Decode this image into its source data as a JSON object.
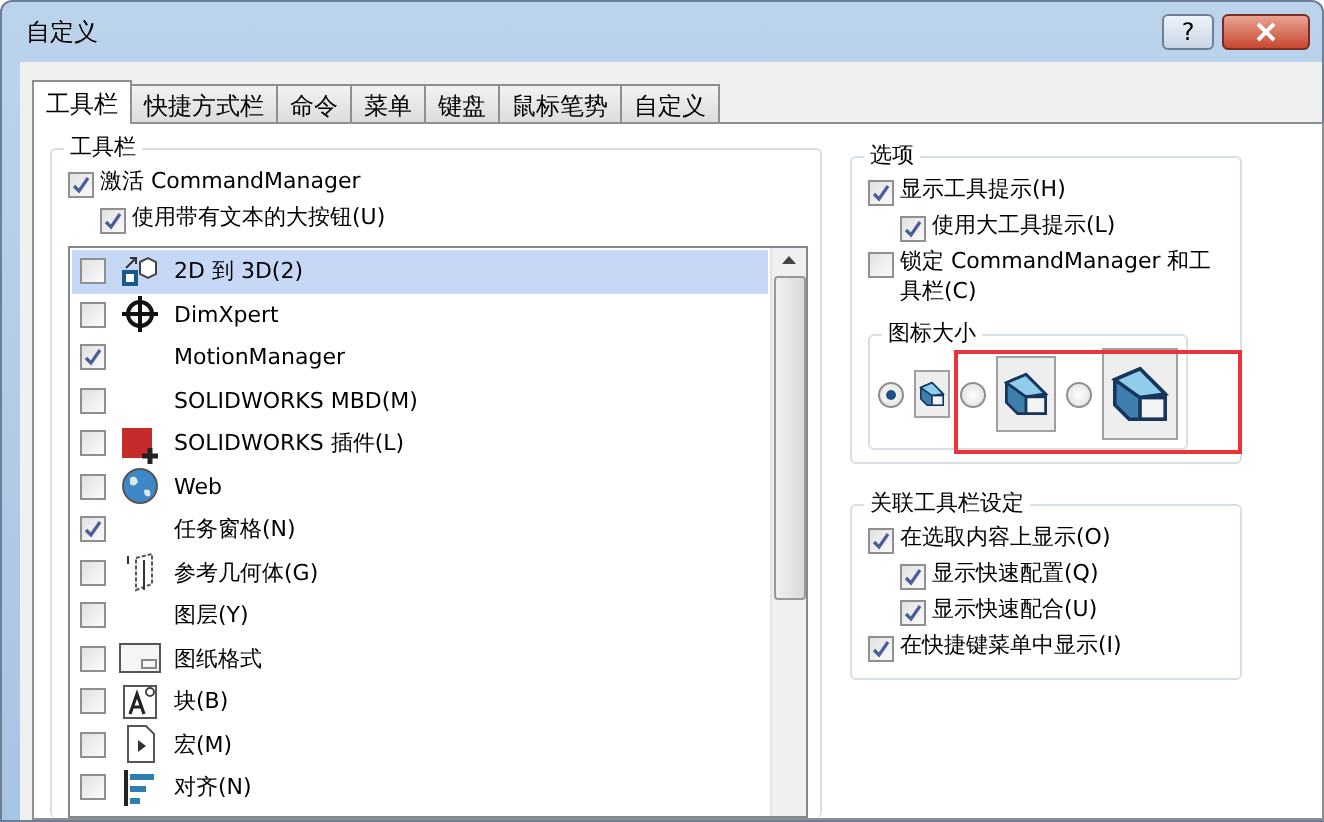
{
  "window": {
    "title": "自定义",
    "help_button": "?"
  },
  "tabs": [
    {
      "label": "工具栏",
      "selected": true
    },
    {
      "label": "快捷方式栏",
      "selected": false
    },
    {
      "label": "命令",
      "selected": false
    },
    {
      "label": "菜单",
      "selected": false
    },
    {
      "label": "键盘",
      "selected": false
    },
    {
      "label": "鼠标笔势",
      "selected": false
    },
    {
      "label": "自定义",
      "selected": false
    }
  ],
  "toolbars": {
    "title": "工具栏",
    "options": [
      {
        "label": "激活 CommandManager",
        "checked": true,
        "indented": false
      },
      {
        "label": "使用带有文本的大按钮(U)",
        "checked": true,
        "indented": true
      }
    ],
    "items": [
      {
        "label": "2D 到 3D(2)",
        "checked": false,
        "selected": true,
        "kind": "cube"
      },
      {
        "label": "DimXpert",
        "checked": false,
        "selected": false,
        "kind": "crosshair"
      },
      {
        "label": "MotionManager",
        "checked": true,
        "selected": false,
        "kind": "none"
      },
      {
        "label": "SOLIDWORKS MBD(M)",
        "checked": false,
        "selected": false,
        "kind": "none"
      },
      {
        "label": "SOLIDWORKS 插件(L)",
        "checked": false,
        "selected": false,
        "kind": "addin"
      },
      {
        "label": "Web",
        "checked": false,
        "selected": false,
        "kind": "globe"
      },
      {
        "label": "任务窗格(N)",
        "checked": true,
        "selected": false,
        "kind": "none"
      },
      {
        "label": "参考几何体(G)",
        "checked": false,
        "selected": false,
        "kind": "plane"
      },
      {
        "label": "图层(Y)",
        "checked": false,
        "selected": false,
        "kind": "none"
      },
      {
        "label": "图纸格式",
        "checked": false,
        "selected": false,
        "kind": "sheet"
      },
      {
        "label": "块(B)",
        "checked": false,
        "selected": false,
        "kind": "block"
      },
      {
        "label": "宏(M)",
        "checked": false,
        "selected": false,
        "kind": "macro"
      },
      {
        "label": "对齐(N)",
        "checked": false,
        "selected": false,
        "kind": "align"
      }
    ]
  },
  "options": {
    "title": "选项",
    "items": [
      {
        "label": "显示工具提示(H)",
        "checked": true,
        "indented": false
      },
      {
        "label": "使用大工具提示(L)",
        "checked": true,
        "indented": true
      },
      {
        "label": "锁定 CommandManager 和工具栏(C)",
        "checked": false,
        "indented": false
      }
    ],
    "icon_size": {
      "title": "图标大小",
      "choices": [
        {
          "kind": "small",
          "selected": true
        },
        {
          "kind": "medium",
          "selected": false
        },
        {
          "kind": "large",
          "selected": false
        }
      ]
    }
  },
  "context_toolbar": {
    "title": "关联工具栏设定",
    "items": [
      {
        "label": "在选取内容上显示(O)",
        "checked": true,
        "indented": false
      },
      {
        "label": "显示快速配置(Q)",
        "checked": true,
        "indented": true
      },
      {
        "label": "显示快速配合(U)",
        "checked": true,
        "indented": true
      },
      {
        "label": "在快捷键菜单中显示(I)",
        "checked": true,
        "indented": false
      }
    ]
  }
}
